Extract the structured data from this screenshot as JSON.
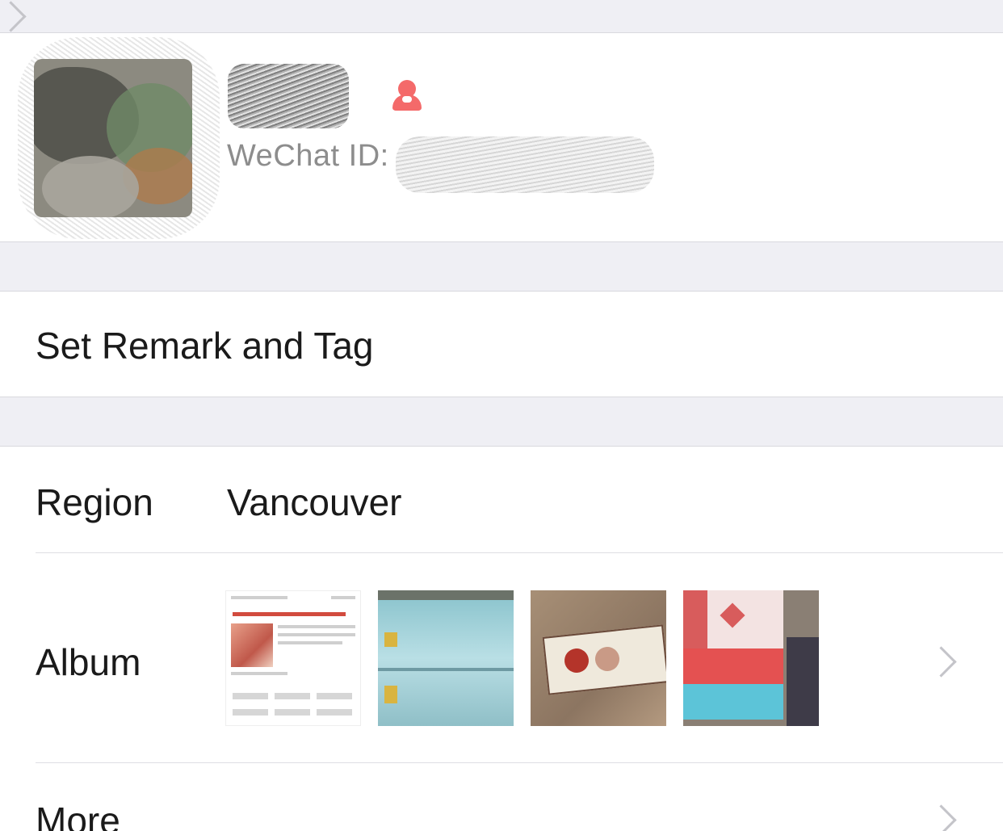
{
  "profile": {
    "wechat_id_label": "WeChat ID:",
    "gender_icon": "female-icon",
    "gender_color": "#f46a6a"
  },
  "remark_row": {
    "label": "Set Remark and Tag"
  },
  "details": {
    "region_label": "Region",
    "region_value": "Vancouver",
    "album_label": "Album",
    "more_label": "More",
    "album_thumbnails": [
      "thumbnail-1",
      "thumbnail-2",
      "thumbnail-3",
      "thumbnail-4"
    ]
  },
  "colors": {
    "background": "#efeff4",
    "row_background": "#ffffff",
    "chevron": "#c4c4c9",
    "secondary_text": "#8d8d8d"
  }
}
